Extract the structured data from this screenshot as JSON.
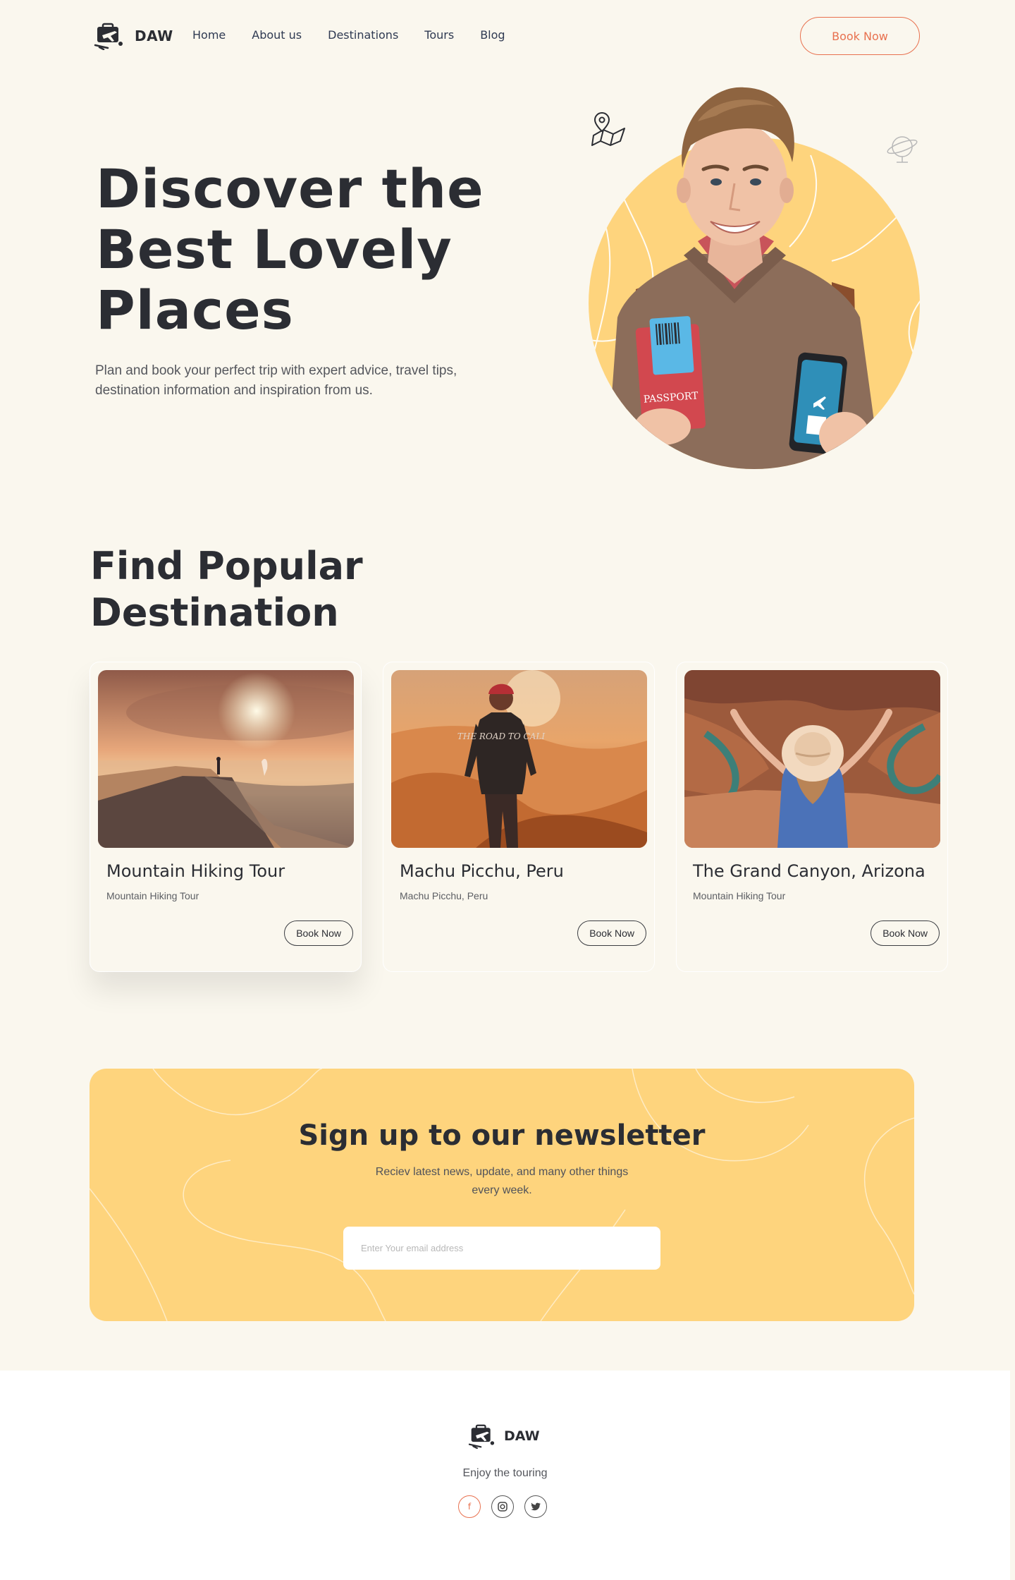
{
  "brand": {
    "name": "DAW",
    "logo_icon": "travel-plane-logo-icon"
  },
  "nav": {
    "links": [
      "Home",
      "About us",
      "Destinations",
      "Tours",
      "Blog"
    ],
    "cta": "Book Now"
  },
  "hero": {
    "title_lines": [
      "Discover the",
      "Best Lovely",
      "Places"
    ],
    "subtitle": "Plan and book your perfect trip with expert advice, travel tips, destination information and inspiration from us.",
    "image_alt": "Smiling traveler holding passport and phone with e-ticket",
    "passport_label": "PASSPORT",
    "decor_icons": [
      "map-pin-icon",
      "globe-icon"
    ]
  },
  "destinations": {
    "title": "Find Popular Destination",
    "cards": [
      {
        "title": "Mountain Hiking Tour",
        "subtitle": "Mountain Hiking Tour",
        "button": "Book Now"
      },
      {
        "title": "Machu Picchu, Peru",
        "subtitle": "Machu Picchu, Peru",
        "button": "Book Now",
        "shirt_text": "THE ROAD TO CALI"
      },
      {
        "title": "The Grand Canyon, Arizona",
        "subtitle": "Mountain Hiking Tour",
        "button": "Book Now"
      }
    ]
  },
  "newsletter": {
    "title": "Sign up to our newsletter",
    "subtitle": "Reciev latest news, update, and many other things every week.",
    "email_placeholder": "Enter Your email address"
  },
  "footer": {
    "brand": "DAW",
    "tagline": "Enjoy the touring",
    "socials": [
      "facebook-icon",
      "instagram-icon",
      "twitter-icon"
    ]
  },
  "colors": {
    "accent": "#e8714f",
    "yellow": "#fed47d",
    "background": "#faf7ee",
    "text": "#2b2d33"
  }
}
